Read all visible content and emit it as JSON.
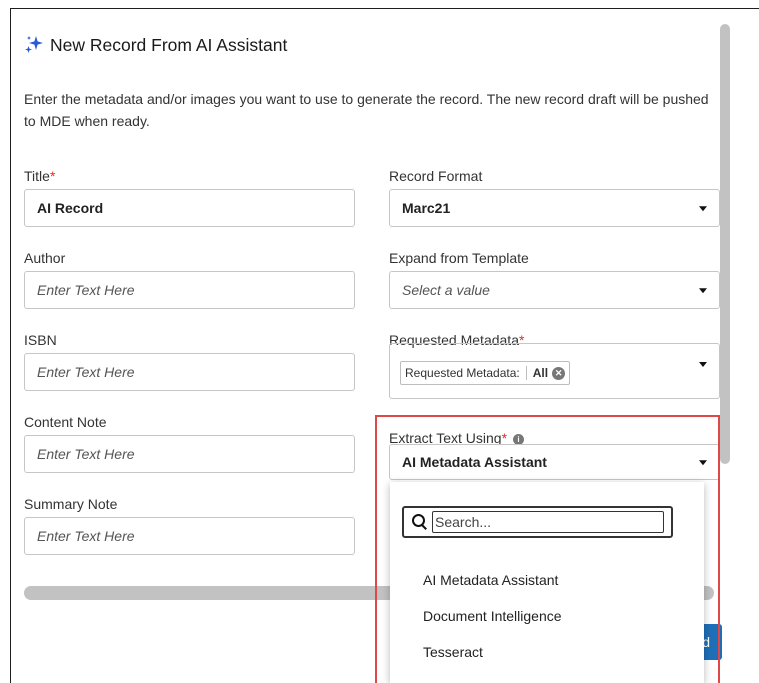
{
  "dialog": {
    "title": "New Record From AI Assistant",
    "description": "Enter the metadata and/or images you want to use to generate the record. The new record draft will be pushed to MDE when ready."
  },
  "fields": {
    "title": {
      "label": "Title",
      "required_mark": "*",
      "value": "AI Record"
    },
    "author": {
      "label": "Author",
      "placeholder": "Enter Text Here"
    },
    "isbn": {
      "label": "ISBN",
      "placeholder": "Enter Text Here"
    },
    "content_note": {
      "label": "Content Note",
      "placeholder": "Enter Text Here"
    },
    "summary_note": {
      "label": "Summary Note",
      "placeholder": "Enter Text Here"
    },
    "record_format": {
      "label": "Record Format",
      "value": "Marc21"
    },
    "expand_template": {
      "label": "Expand from Template",
      "placeholder": "Select a value"
    },
    "requested_metadata": {
      "label": "Requested Metadata",
      "required_mark": "*",
      "chip_label": "Requested Metadata:",
      "chip_value": "All"
    },
    "extract_text": {
      "label": "Extract Text Using",
      "required_mark": "*",
      "value": "AI Metadata Assistant"
    }
  },
  "dropdown": {
    "search_placeholder": "Search...",
    "options": [
      "AI Metadata Assistant",
      "Document Intelligence",
      "Tesseract"
    ]
  },
  "footer": {
    "button_partial": "rd"
  },
  "icons": {
    "title_icon": "sparkle-icon",
    "info": "info-icon",
    "search": "search-icon",
    "chip_clear": "close-circle-icon",
    "dropdown": "chevron-down-icon"
  },
  "colors": {
    "required": "#d93025",
    "highlight": "#e04848",
    "primary_button": "#1f6fb8",
    "sparkle": "#2a5bd7"
  }
}
